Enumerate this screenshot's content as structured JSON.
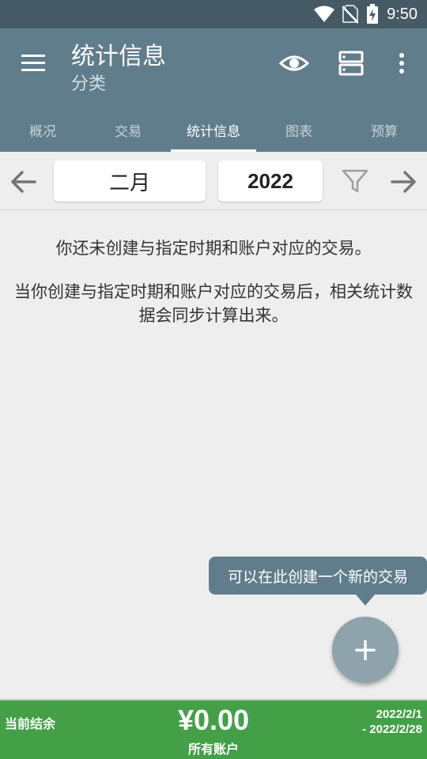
{
  "status_bar": {
    "time": "9:50",
    "icons": [
      "wifi-icon",
      "no-sim-icon",
      "battery-charging-icon"
    ]
  },
  "app_bar": {
    "title": "统计信息",
    "subtitle": "分类",
    "actions": [
      "eye-icon",
      "view-list-icon",
      "more-vert-icon"
    ]
  },
  "tabs": [
    {
      "label": "概况",
      "active": false
    },
    {
      "label": "交易",
      "active": false
    },
    {
      "label": "统计信息",
      "active": true
    },
    {
      "label": "图表",
      "active": false
    },
    {
      "label": "预算",
      "active": false
    }
  ],
  "period": {
    "month": "二月",
    "year": "2022"
  },
  "empty_state": {
    "message": "你还未创建与指定时期和账户对应的交易。",
    "hint": "当你创建与指定时期和账户对应的交易后，相关统计数据会同步计算出来。"
  },
  "tooltip": {
    "text": "可以在此创建一个新的交易"
  },
  "fab": {
    "label": "+"
  },
  "footer": {
    "balance_label": "当前结余",
    "amount": "¥0.00",
    "accounts": "所有账户",
    "date_from": "2022/2/1",
    "date_to": "- 2022/2/28"
  },
  "colors": {
    "primary": "#607d8b",
    "status_bar": "#455a64",
    "balance_green": "#43a047"
  }
}
